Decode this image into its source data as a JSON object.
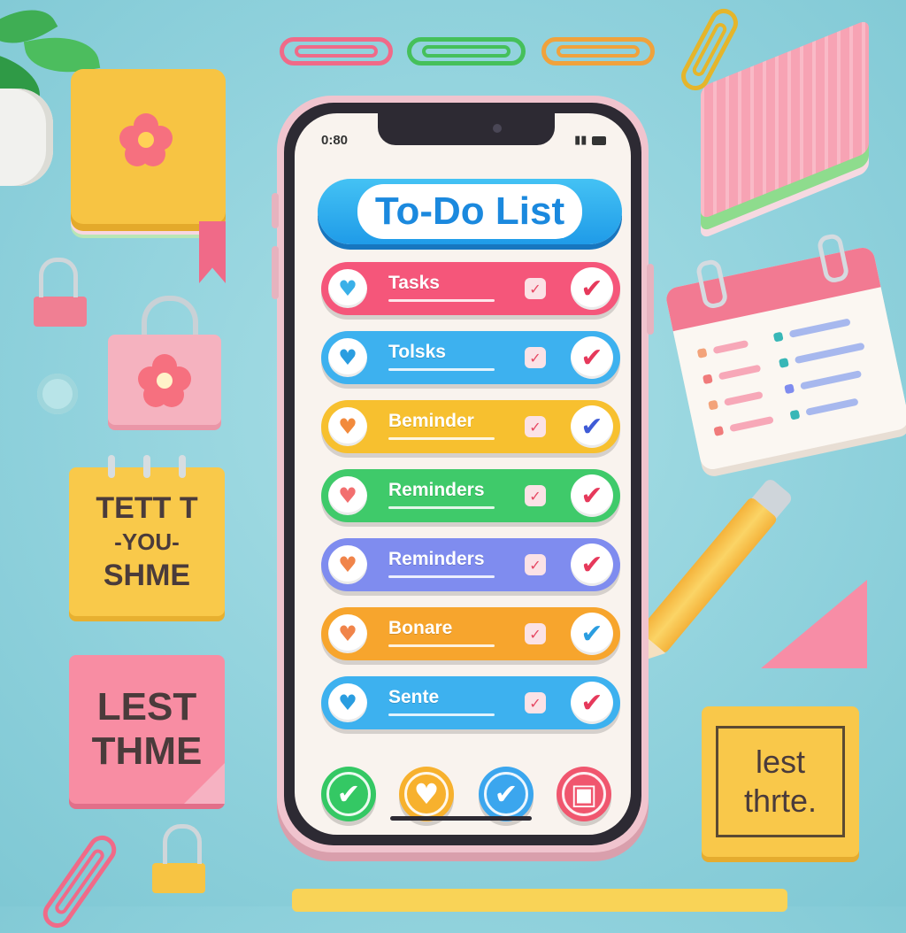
{
  "status_bar": {
    "time": "0:80",
    "signal": "📶",
    "battery_icon": "battery-icon"
  },
  "app": {
    "title": "To-Do List"
  },
  "tasks": [
    {
      "label": "Tasks",
      "color": "#f5567a",
      "heart_color": "#3ab0e8",
      "check_color": "#e6395b"
    },
    {
      "label": "Tolsks",
      "color": "#3db1ef",
      "heart_color": "#2a9de0",
      "check_color": "#e6395b"
    },
    {
      "label": "Beminder",
      "color": "#f7c02f",
      "heart_color": "#f28a3c",
      "check_color": "#3f5bd6"
    },
    {
      "label": "Reminders",
      "color": "#3fca6a",
      "heart_color": "#f26f6f",
      "check_color": "#e6395b"
    },
    {
      "label": "Reminders",
      "color": "#7f8cef",
      "heart_color": "#f0844a",
      "check_color": "#e6395b"
    },
    {
      "label": "Bonare",
      "color": "#f7a52d",
      "heart_color": "#f0844a",
      "check_color": "#2a9de0"
    },
    {
      "label": "Sente",
      "color": "#3db1ef",
      "heart_color": "#2a9de0",
      "check_color": "#e6395b"
    }
  ],
  "bottom_actions": [
    {
      "name": "complete-button",
      "glyph": "✔",
      "color": "#34c864"
    },
    {
      "name": "favorite-button",
      "glyph": "♥",
      "color": "#f7b12e"
    },
    {
      "name": "done-button",
      "glyph": "✔",
      "color": "#3ba6ee"
    },
    {
      "name": "calendar-button",
      "glyph": "▣",
      "color": "#f0566e"
    }
  ],
  "desk_notes": {
    "yellow_note": [
      "TETT T",
      "-YOU-",
      "SHME"
    ],
    "pink_note": [
      "LEST",
      "THME"
    ],
    "lest_note": [
      "lest",
      "thrte."
    ]
  }
}
